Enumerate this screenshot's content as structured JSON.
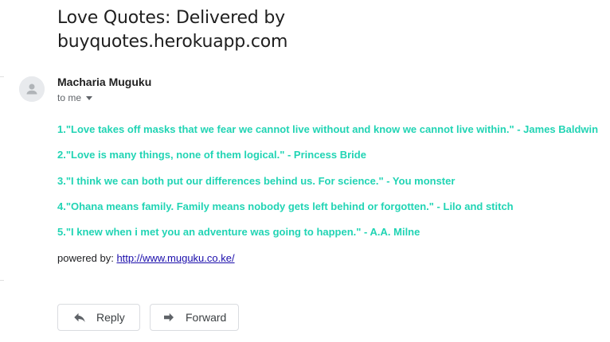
{
  "email": {
    "subject": "Love Quotes: Delivered by buyquotes.herokuapp.com",
    "sender_name": "Macharia Muguku",
    "recipient": "to me",
    "quotes": [
      "1.\"Love takes off masks that we fear we cannot live without and know we cannot live within.\" - James Baldwin",
      "2.\"Love is many things, none of them logical.\" - Princess Bride",
      "3.\"I think we can both put our differences behind us. For science.\" - You monster",
      "4.\"Ohana means family. Family means nobody gets left behind or forgotten.\" - Lilo and stitch",
      "5.\"I knew when i met you an adventure was going to happen.\" - A.A. Milne"
    ],
    "powered_by_label": "powered by:",
    "powered_by_link": "http://www.muguku.co.ke/",
    "quote_color": "#21d4b4"
  },
  "actions": {
    "reply_label": "Reply",
    "forward_label": "Forward"
  },
  "icons": {
    "avatar": "default-person-avatar",
    "caret": "caret-down-icon",
    "reply": "reply-arrow-icon",
    "forward": "forward-arrow-icon"
  }
}
